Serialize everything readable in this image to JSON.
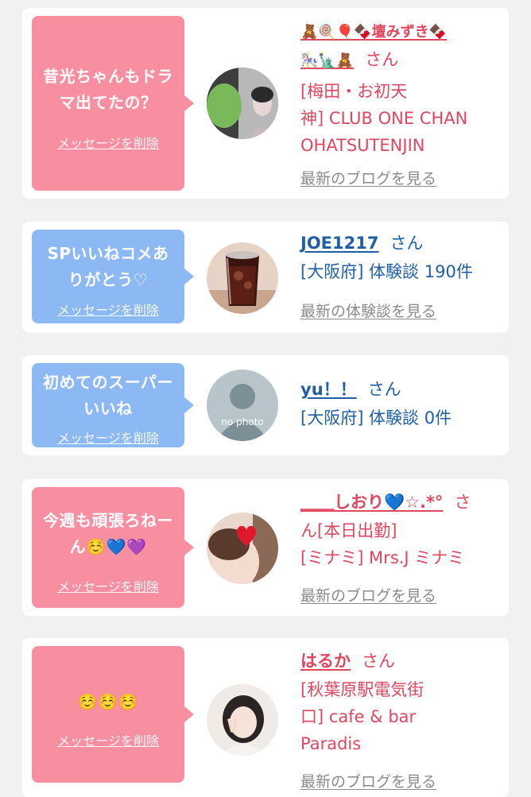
{
  "delete_label": "メッセージを削除",
  "colors": {
    "pink_bubble": "#f88fa0",
    "blue_bubble": "#8cb8f4",
    "pink_text": "#e0465e",
    "blue_text": "#1e5fa8",
    "link_gray": "#8a8a8a"
  },
  "cards": [
    {
      "bubble_color": "pink",
      "message_lines": [
        "昔光ちゃんもドラ",
        "マ出てたの？"
      ],
      "avatar": "photo-portrait-green-icon",
      "name_lines": [
        "🧸🍭🎈🍫壇みずき🍫",
        "🎠🗽🧸"
      ],
      "honorific": "さん",
      "detail_lines": [
        "[梅田・お初天",
        "神] CLUB ONE CHAN",
        "OHATSUTENJIN"
      ],
      "link": "最新のブログを見る"
    },
    {
      "bubble_color": "blue",
      "message_lines": [
        "SPいいねコメあ",
        "りがとう♡"
      ],
      "avatar": "photo-drink-glass-icon",
      "name_lines": [
        "JOE1217"
      ],
      "honorific": "さん",
      "detail_lines": [
        "[大阪府] 体験談 190件"
      ],
      "link": "最新の体験談を見る"
    },
    {
      "bubble_color": "blue",
      "message_lines": [
        "初めてのスーパー",
        "いいね"
      ],
      "avatar": "no-photo-icon",
      "avatar_text": "no photo",
      "name_lines": [
        "yu！！"
      ],
      "honorific": "さん",
      "detail_lines": [
        "[大阪府] 体験談 0件"
      ],
      "link": ""
    },
    {
      "bubble_color": "pink",
      "message_lines": [
        "今週も頑張ろねー",
        "ん☺️💙💜"
      ],
      "avatar": "photo-heart-portrait-icon",
      "name_lines": [
        "＿＿しおり💙☆.*°"
      ],
      "honorific": "さ",
      "detail_lines": [
        "ん[本日出勤]",
        "[ミナミ] Mrs.J ミナミ"
      ],
      "link": "最新のブログを見る"
    },
    {
      "bubble_color": "pink",
      "message_lines": [
        "☺️☺️☺️"
      ],
      "avatar": "photo-portrait-peace-icon",
      "name_lines": [
        "はるか"
      ],
      "honorific": "さん",
      "detail_lines": [
        "[秋葉原駅電気街",
        "口] cafe & bar",
        "Paradis"
      ],
      "link": "最新のブログを見る"
    }
  ]
}
